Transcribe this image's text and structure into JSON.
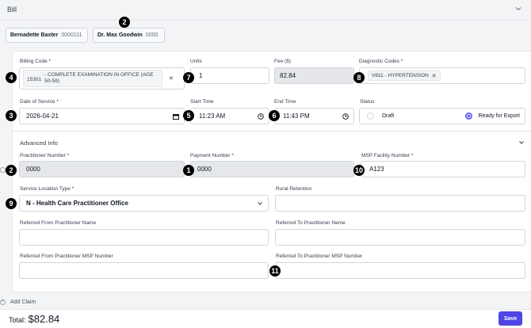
{
  "header": {
    "title": "Bill"
  },
  "practitioners": [
    {
      "name": "Bernadette Baxter",
      "number": "0000111"
    },
    {
      "name": "Dr. Max Goodwin",
      "number": "0000"
    }
  ],
  "fields": {
    "billing_code": {
      "label": "Billing Code *",
      "code": "15301",
      "desc": "- COMPLETE EXAMINATION IN OFFICE (AGE",
      "desc2": "50-59)"
    },
    "units": {
      "label": "Units",
      "value": "1"
    },
    "fee": {
      "label": "Fee ($)",
      "value": "82.84"
    },
    "diagnostic": {
      "label": "Diagnostic Codes *",
      "tag": "V811 - HYPERTENSION"
    },
    "date_of_service": {
      "label": "Date of Service *",
      "value": "2026-04-21"
    },
    "start_time": {
      "label": "Start Time",
      "value": "11:23 AM"
    },
    "end_time": {
      "label": "End Time",
      "value": "11:43 PM"
    },
    "status": {
      "label": "Status",
      "options": [
        "Draft",
        "Ready for Export"
      ],
      "selected": "Ready for Export"
    }
  },
  "advanced": {
    "title": "Advanced Info",
    "practitioner_number": {
      "label": "Practitioner Number *",
      "value": "0000"
    },
    "payment_number": {
      "label": "Payment Number *",
      "value": "0000"
    },
    "msp_facility": {
      "label": "MSP Facility Number *",
      "value": "A123"
    },
    "service_location": {
      "label": "Service Location Type *",
      "value": "N - Health Care Practitioner Office"
    },
    "rural_retention": {
      "label": "Rural Retention",
      "value": ""
    },
    "ref_from_name": {
      "label": "Referred From Practitioner Name",
      "value": ""
    },
    "ref_to_name": {
      "label": "Referred To Practitioner Name",
      "value": ""
    },
    "ref_from_msp": {
      "label": "Referred From Practitioner MSP Number",
      "value": ""
    },
    "ref_to_msp": {
      "label": "Referred To Practitioner MSP Number",
      "value": ""
    }
  },
  "add_claim": "Add Claim",
  "total_label": "Total:",
  "total_value": "$82.84",
  "save_label": "Save",
  "badges": {
    "b1": "1",
    "b2": "2",
    "b3": "3",
    "b4": "4",
    "b5": "5",
    "b6": "6",
    "b7": "7",
    "b8": "8",
    "b9": "9",
    "b10": "10",
    "b11": "11"
  }
}
